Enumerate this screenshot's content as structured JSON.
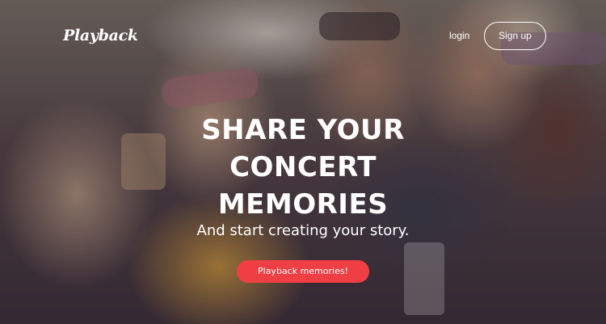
{
  "header": {
    "logo_text": "Playback",
    "login_label": "login",
    "signup_label": "Sign up"
  },
  "hero": {
    "headline_lines": [
      "SHARE YOUR",
      "CONCERT",
      "MEMORIES"
    ],
    "subtitle": "And start creating your story.",
    "cta_label": "Playback memories!"
  },
  "colors": {
    "accent": "#ef3f45",
    "text": "#ffffff"
  }
}
